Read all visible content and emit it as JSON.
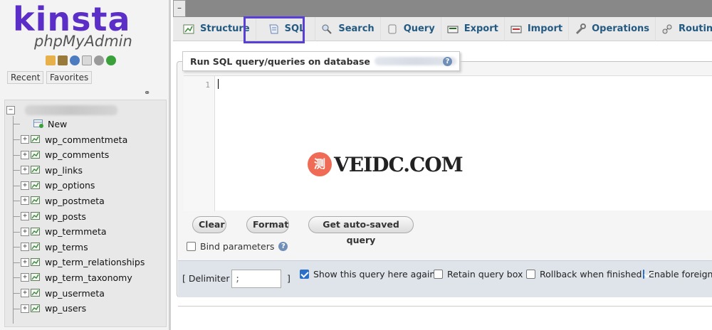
{
  "nav": {
    "logo_brand": "kinsta",
    "logo_app": "phpMyAdmin",
    "icons": [
      "home-icon",
      "exit-icon",
      "help-icon",
      "docs-icon",
      "settings-icon",
      "reload-icon"
    ],
    "tabs": {
      "recent": "Recent",
      "favorites": "Favorites"
    },
    "tree": {
      "database_name_redacted": true,
      "new_label": "New",
      "tables": [
        "wp_commentmeta",
        "wp_comments",
        "wp_links",
        "wp_options",
        "wp_postmeta",
        "wp_posts",
        "wp_termmeta",
        "wp_terms",
        "wp_term_relationships",
        "wp_term_taxonomy",
        "wp_usermeta",
        "wp_users"
      ]
    }
  },
  "topbar": {
    "collapse_label": "–"
  },
  "tabs": [
    {
      "label": "Structure",
      "icon": "structure-icon"
    },
    {
      "label": "SQL",
      "icon": "sql-icon",
      "active": true
    },
    {
      "label": "Search",
      "icon": "search-icon"
    },
    {
      "label": "Query",
      "icon": "query-icon"
    },
    {
      "label": "Export",
      "icon": "export-icon"
    },
    {
      "label": "Import",
      "icon": "import-icon"
    },
    {
      "label": "Operations",
      "icon": "wrench-icon"
    },
    {
      "label": "Routines",
      "icon": "routines-icon"
    }
  ],
  "panel": {
    "legend": "Run SQL query/queries on database",
    "editor": {
      "line_number": "1",
      "content": ""
    },
    "buttons": {
      "clear": "Clear",
      "format": "Format",
      "autosaved": "Get auto-saved query"
    },
    "bind_parameters": {
      "label": "Bind parameters",
      "checked": false
    }
  },
  "options": {
    "delimiter_label": "[ Delimiter",
    "delimiter_value": ";",
    "delimiter_close": "]",
    "show_query": {
      "label": "Show this query here again",
      "checked": true
    },
    "retain_box": {
      "label": "Retain query box",
      "checked": false
    },
    "rollback": {
      "label": "Rollback when finished",
      "checked": false
    },
    "foreign": {
      "label": "Enable foreign key checks",
      "checked": true
    }
  },
  "watermark": {
    "badge": "测",
    "text": "VEIDC.COM"
  },
  "colors": {
    "accent": "#5a3fd6",
    "brand": "#5b2ec7",
    "tab_text": "#235a81",
    "checkbox": "#2a6fc9"
  }
}
